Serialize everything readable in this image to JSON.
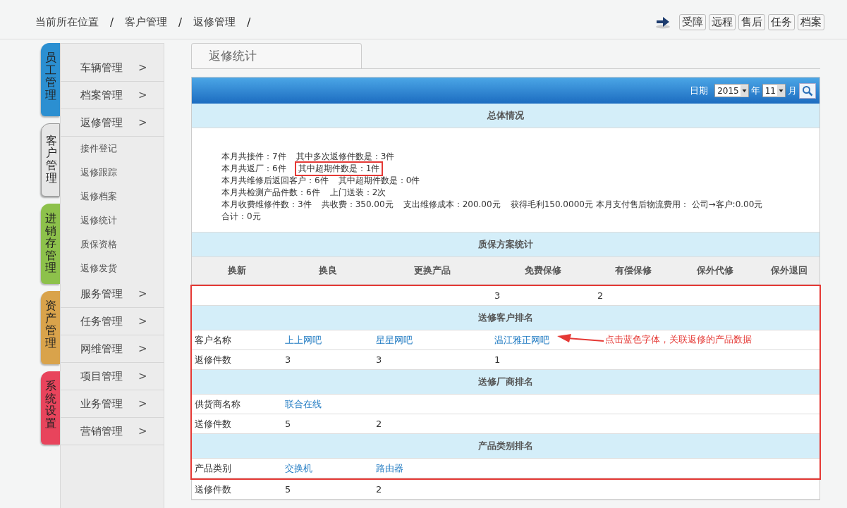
{
  "breadcrumb": [
    "当前所在位置",
    "客户管理",
    "返修管理"
  ],
  "breadcrumb_separator": "/",
  "quick_buttons": [
    "受障",
    "远程",
    "售后",
    "任务",
    "档案"
  ],
  "side_tabs": [
    {
      "label": "员工管理",
      "color": "#2b8fd1",
      "selected": false
    },
    {
      "label": "客户管理",
      "color": "#e6e6e6",
      "selected": true
    },
    {
      "label": "进销存管理",
      "color": "#8dc14b",
      "selected": false
    },
    {
      "label": "资产管理",
      "color": "#d9a34b",
      "selected": false
    },
    {
      "label": "系统设置",
      "color": "#e8445c",
      "selected": false
    }
  ],
  "menu": [
    {
      "label": "车辆管理",
      "kind": "group",
      "arrow": ">"
    },
    {
      "label": "档案管理",
      "kind": "group",
      "arrow": ">"
    },
    {
      "label": "返修管理",
      "kind": "group",
      "arrow": ">"
    },
    {
      "label": "接件登记",
      "kind": "sub"
    },
    {
      "label": "返修跟踪",
      "kind": "sub"
    },
    {
      "label": "返修档案",
      "kind": "sub"
    },
    {
      "label": "返修统计",
      "kind": "sub"
    },
    {
      "label": "质保资格",
      "kind": "sub"
    },
    {
      "label": "返修发货",
      "kind": "sub"
    },
    {
      "label": "服务管理",
      "kind": "group",
      "arrow": ">"
    },
    {
      "label": "任务管理",
      "kind": "group",
      "arrow": ">"
    },
    {
      "label": "网维管理",
      "kind": "group",
      "arrow": ">"
    },
    {
      "label": "项目管理",
      "kind": "group",
      "arrow": ">"
    },
    {
      "label": "业务管理",
      "kind": "group",
      "arrow": ">"
    },
    {
      "label": "营销管理",
      "kind": "group",
      "arrow": ">"
    }
  ],
  "page_tab": "返修统计",
  "date_filter": {
    "label": "日期",
    "year": "2015",
    "year_unit": "年",
    "month": "11",
    "month_unit": "月"
  },
  "summary": {
    "title": "总体情况",
    "lines": [
      [
        {
          "text": "本月共接件：7件",
          "highlighted": false
        },
        {
          "text": "其中多次返修件数是：3件",
          "highlighted": false
        }
      ],
      [
        {
          "text": "本月共返厂：6件",
          "highlighted": false
        },
        {
          "text": "其中超期件数是：1件",
          "highlighted": true
        }
      ],
      [
        {
          "text": "本月共维修后返回客户：6件",
          "highlighted": false
        },
        {
          "text": "其中超期件数是：0件",
          "highlighted": false
        }
      ],
      [
        {
          "text": "本月共检测产品件数：6件",
          "highlighted": false
        },
        {
          "text": "上门送装：2次",
          "highlighted": false
        }
      ],
      [
        {
          "text": "本月收费维修件数：3件",
          "highlighted": false
        },
        {
          "text": "共收费：350.00元",
          "highlighted": false
        },
        {
          "text": "支出维修成本：200.00元",
          "highlighted": false
        },
        {
          "text": "获得毛利150.0000元 本月支付售后物流费用： 公司→客户:0.00元",
          "highlighted": false
        },
        {
          "text": "合计：0元",
          "highlighted": false
        }
      ]
    ]
  },
  "warranty": {
    "title": "质保方案统计",
    "columns": [
      "换新",
      "换良",
      "更换产品",
      "免费保修",
      "有偿保修",
      "保外代修",
      "保外退回"
    ]
  },
  "framed_rows": [
    {
      "kind": "values",
      "cells": [
        "",
        "",
        "",
        "3",
        "2",
        "",
        ""
      ]
    },
    {
      "kind": "title",
      "text": "送修客户排名"
    },
    {
      "kind": "values",
      "cells": [
        "客户名称",
        "上上网吧",
        "星星网吧",
        "温江雅正网吧"
      ],
      "links": true,
      "annotation": "点击蓝色字体，关联返修的产品数据"
    },
    {
      "kind": "values",
      "cells": [
        "返修件数",
        "3",
        "3",
        "1"
      ]
    },
    {
      "kind": "title",
      "text": "送修厂商排名"
    },
    {
      "kind": "values",
      "cells": [
        "供货商名称",
        "联合在线"
      ],
      "links": true
    },
    {
      "kind": "values",
      "cells": [
        "送修件数",
        "5",
        "2"
      ]
    },
    {
      "kind": "title",
      "text": "产品类别排名"
    },
    {
      "kind": "values",
      "cells": [
        "产品类别",
        "交换机",
        "路由器"
      ],
      "links": true
    }
  ],
  "after_rows": [
    {
      "kind": "values",
      "cells": [
        "送修件数",
        "5",
        "2"
      ]
    }
  ]
}
